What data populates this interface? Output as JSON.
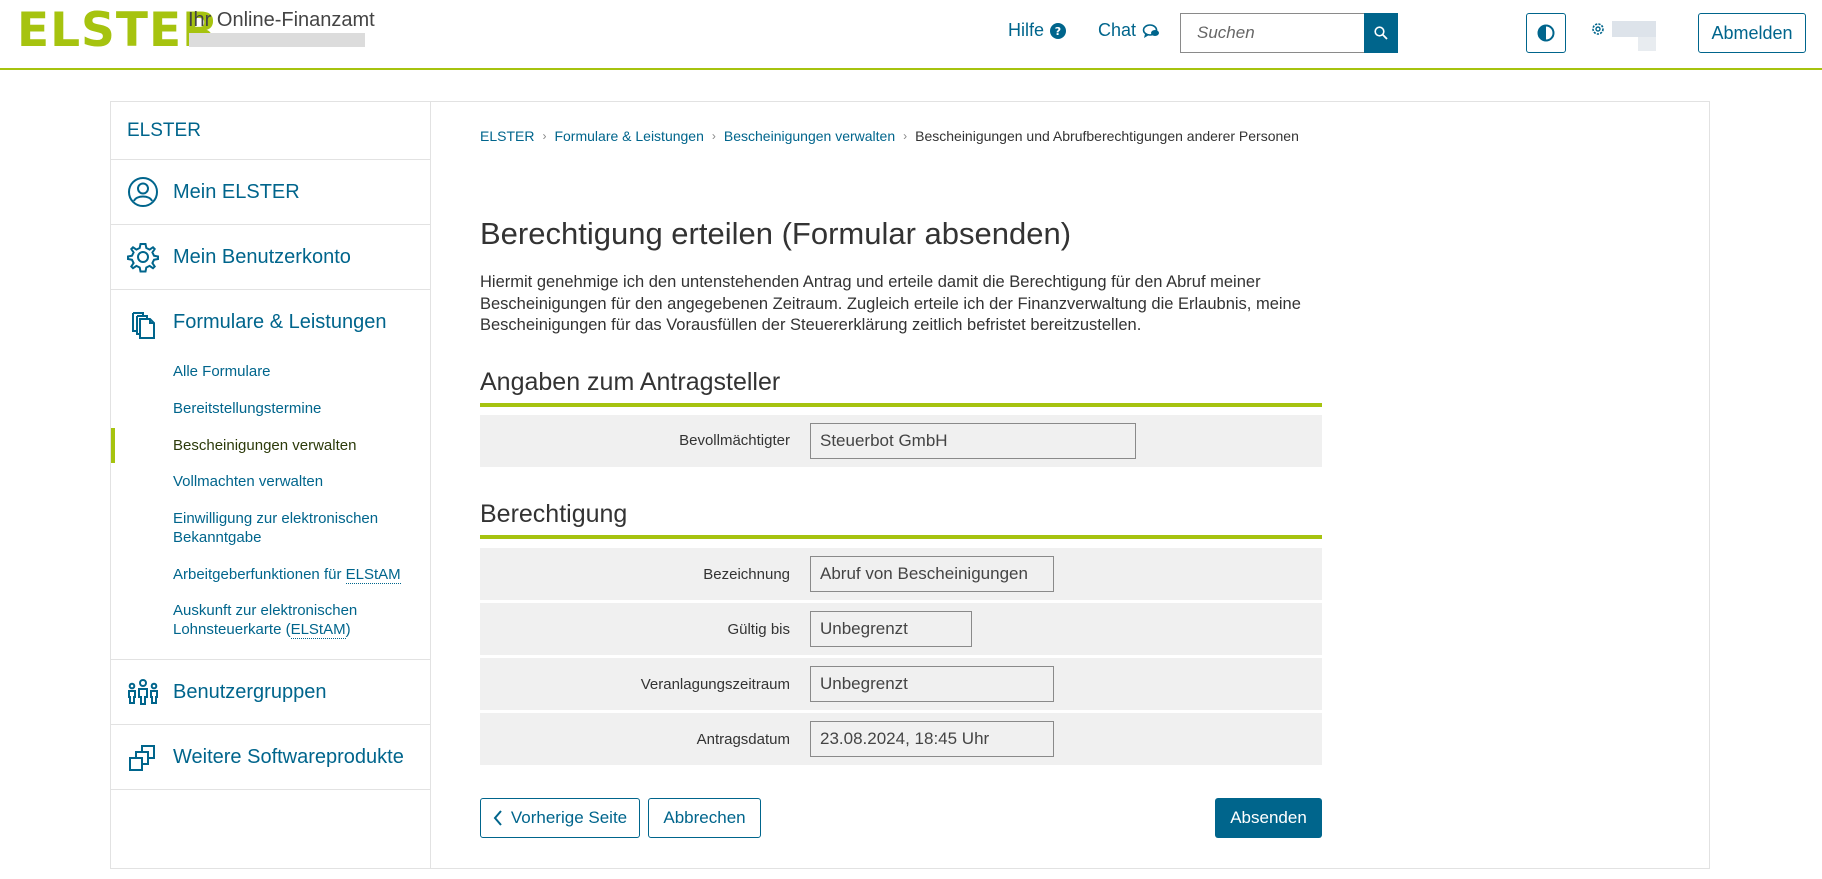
{
  "header": {
    "logo": "ELSTER",
    "tagline": "Ihr Online-Finanzamt",
    "help_label": "Hilfe",
    "chat_label": "Chat",
    "search_placeholder": "Suchen",
    "logout_label": "Abmelden"
  },
  "sidebar": {
    "title": "ELSTER",
    "main_items": [
      {
        "label": "Mein ELSTER",
        "icon": "user-circle-icon"
      },
      {
        "label": "Mein Benutzerkonto",
        "icon": "gear-icon"
      },
      {
        "label": "Formulare & Leistungen",
        "icon": "documents-icon"
      },
      {
        "label": "Benutzergruppen",
        "icon": "user-group-icon"
      },
      {
        "label": "Weitere Softwareprodukte",
        "icon": "software-icon"
      }
    ],
    "sub_items": [
      {
        "label": "Alle Formulare"
      },
      {
        "label": "Bereitstellungstermine"
      },
      {
        "label": "Bescheinigungen verwalten"
      },
      {
        "label": "Vollmachten verwalten"
      },
      {
        "label": "Einwilligung zur elektronischen Bekanntgabe"
      },
      {
        "label_pre": "Arbeitgeberfunktionen für ",
        "abbr": "ELStAM",
        "label_post": ""
      },
      {
        "label_pre": "Auskunft zur elektronischen Lohnsteuerkarte (",
        "abbr": "ELStAM",
        "label_post": ")"
      }
    ]
  },
  "breadcrumb": {
    "items": [
      "ELSTER",
      "Formulare & Leistungen",
      "Bescheinigungen verwalten"
    ],
    "current": "Bescheinigungen und Abrufberechtigungen anderer Personen"
  },
  "main": {
    "title": "Berechtigung erteilen (Formular absenden)",
    "intro": "Hiermit genehmige ich den untenstehenden Antrag und erteile damit die Berechtigung für den Abruf meiner Bescheinigungen für den angegebenen Zeitraum. Zugleich erteile ich der Finanzverwaltung die Erlaubnis, meine Bescheinigungen für das Vorausfüllen der Steuererklärung zeitlich befristet bereitzustellen.",
    "section1": {
      "heading": "Angaben zum Antragsteller",
      "fields": [
        {
          "label": "Bevollmächtigter",
          "value": "Steuerbot GmbH"
        }
      ]
    },
    "section2": {
      "heading": "Berechtigung",
      "fields": [
        {
          "label": "Bezeichnung",
          "value": "Abruf von Bescheinigungen"
        },
        {
          "label": "Gültig bis",
          "value": "Unbegrenzt"
        },
        {
          "label": "Veranlagungszeitraum",
          "value": "Unbegrenzt"
        },
        {
          "label": "Antragsdatum",
          "value": "23.08.2024, 18:45 Uhr"
        }
      ]
    },
    "buttons": {
      "prev": "Vorherige Seite",
      "cancel": "Abbrechen",
      "submit": "Absenden"
    }
  },
  "colors": {
    "brand_green": "#a6c30f",
    "link_blue": "#00658c",
    "row_gray": "#f0f0f0"
  }
}
